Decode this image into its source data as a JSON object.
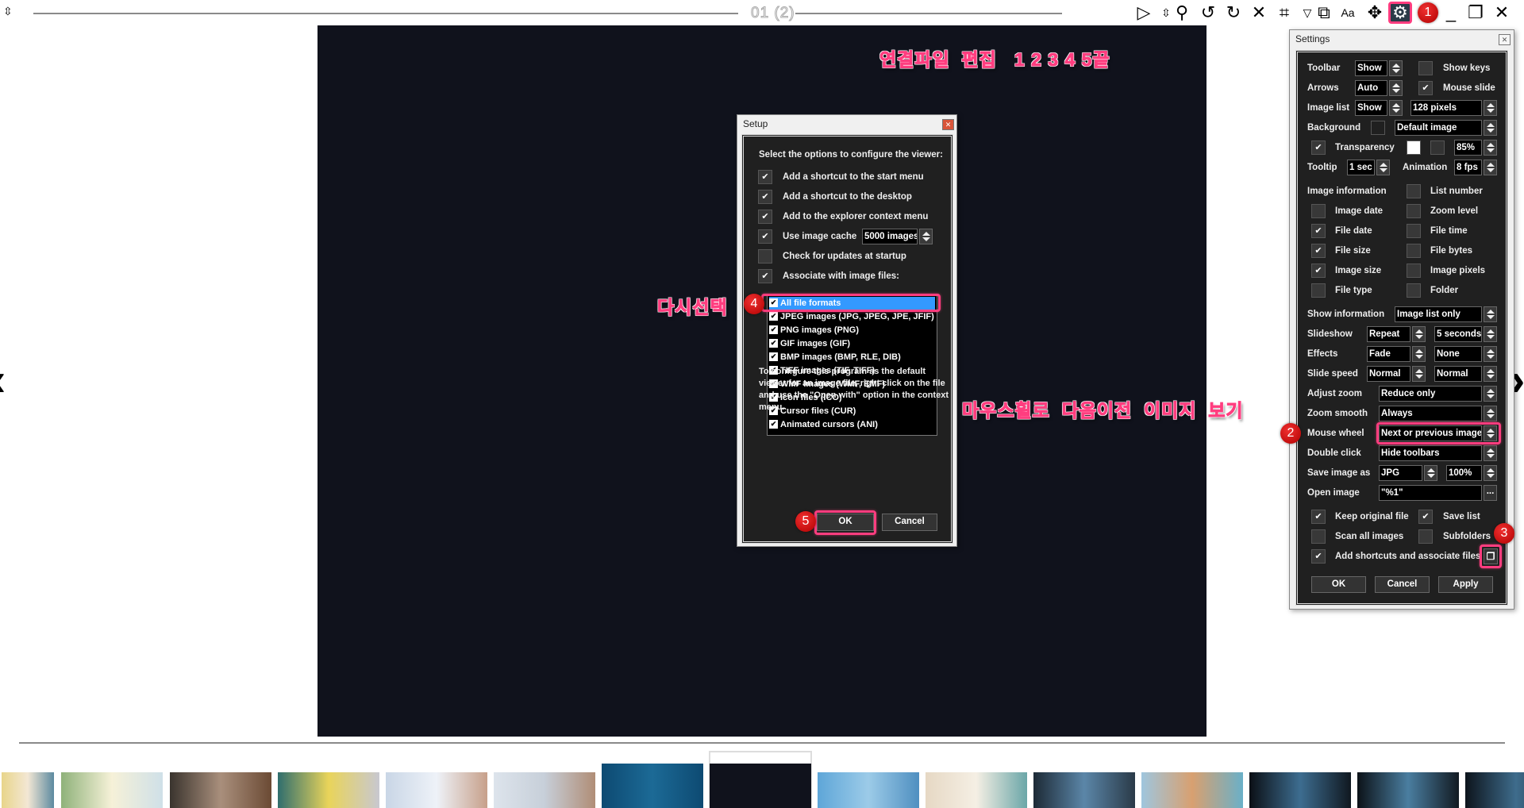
{
  "window": {
    "title": "01 (2)"
  },
  "toolbar": {
    "icons": [
      "menu-toggle-icon",
      "play-icon",
      "zoom-toggle-icon",
      "magnifier-icon",
      "rotate-left-icon",
      "rotate-right-icon",
      "delete-icon",
      "crop-icon",
      "dropdown-icon",
      "find-image-icon",
      "text-icon",
      "move-icon",
      "gear-icon",
      "minimize-icon",
      "restore-icon",
      "close-icon"
    ]
  },
  "annotations": {
    "top_note": "연결파일  편집   1 2 3 4 5끝",
    "reselect_note": "다시선택",
    "wheel_note": "마우스휠로  다음이전  이미지  보기",
    "badges": [
      "1",
      "2",
      "3",
      "4",
      "5"
    ],
    "highlight_color": "#ff3d7f"
  },
  "setup": {
    "title": "Setup",
    "heading": "Select the options to configure the viewer:",
    "options": [
      {
        "label": "Add a shortcut to the start menu",
        "checked": true
      },
      {
        "label": "Add a shortcut to the desktop",
        "checked": true
      },
      {
        "label": "Add to the explorer context menu",
        "checked": true
      },
      {
        "label": "Use image cache",
        "checked": true
      },
      {
        "label": "Check for updates at startup",
        "checked": false
      },
      {
        "label": "Associate with image files:",
        "checked": true
      }
    ],
    "cache_value": "5000 images",
    "formats": [
      {
        "label": "All file formats",
        "checked": true,
        "selected": true
      },
      {
        "label": "JPEG images (JPG, JPEG, JPE, JFIF)",
        "checked": true
      },
      {
        "label": "PNG images (PNG)",
        "checked": true
      },
      {
        "label": "GIF images (GIF)",
        "checked": true
      },
      {
        "label": "BMP images (BMP, RLE, DIB)",
        "checked": true
      },
      {
        "label": "TIFF images (TIF, TIFF)",
        "checked": true
      },
      {
        "label": "WMF images (WMF, EMF)",
        "checked": true
      },
      {
        "label": "Icon files (ICO)",
        "checked": true
      },
      {
        "label": "Cursor files (CUR)",
        "checked": true
      },
      {
        "label": "Animated cursors (ANI)",
        "checked": true
      }
    ],
    "note": "To configure this program as the default viewer for an image file, right click on the file and use the \"Open with\" option in the context menu.",
    "ok": "OK",
    "cancel": "Cancel"
  },
  "settings": {
    "title": "Settings",
    "toolbar": {
      "label": "Toolbar",
      "value": "Show"
    },
    "show_keys": {
      "label": "Show keys",
      "checked": false
    },
    "arrows": {
      "label": "Arrows",
      "value": "Auto"
    },
    "mouse_slide": {
      "label": "Mouse slide",
      "checked": true
    },
    "image_list": {
      "label": "Image list",
      "value": "Show",
      "size": "128 pixels"
    },
    "background": {
      "label": "Background",
      "value": "Default image"
    },
    "transparency": {
      "label": "Transparency",
      "checked": true,
      "value": "85%"
    },
    "tooltip": {
      "label": "Tooltip",
      "value": "1 sec"
    },
    "animation": {
      "label": "Animation",
      "value": "8 fps"
    },
    "image_information": {
      "label": "Image information"
    },
    "info": {
      "list_number": {
        "label": "List number",
        "checked": false
      },
      "image_date": {
        "label": "Image date",
        "checked": false
      },
      "zoom_level": {
        "label": "Zoom level",
        "checked": false
      },
      "file_date": {
        "label": "File date",
        "checked": true
      },
      "file_time": {
        "label": "File time",
        "checked": false
      },
      "file_size": {
        "label": "File size",
        "checked": true
      },
      "file_bytes": {
        "label": "File bytes",
        "checked": false
      },
      "image_size": {
        "label": "Image size",
        "checked": true
      },
      "image_pixels": {
        "label": "Image pixels",
        "checked": false
      },
      "file_type": {
        "label": "File type",
        "checked": false
      },
      "folder": {
        "label": "Folder",
        "checked": false
      }
    },
    "show_information": {
      "label": "Show information",
      "value": "Image list only"
    },
    "slideshow": {
      "label": "Slideshow",
      "value": "Repeat",
      "interval": "5 seconds"
    },
    "effects": {
      "label": "Effects",
      "value": "Fade",
      "value2": "None"
    },
    "slide_speed": {
      "label": "Slide speed",
      "value": "Normal",
      "value2": "Normal"
    },
    "adjust_zoom": {
      "label": "Adjust zoom",
      "value": "Reduce only"
    },
    "zoom_smooth": {
      "label": "Zoom smooth",
      "value": "Always"
    },
    "mouse_wheel": {
      "label": "Mouse wheel",
      "value": "Next or previous image"
    },
    "double_click": {
      "label": "Double click",
      "value": "Hide toolbars"
    },
    "save_image_as": {
      "label": "Save image as",
      "value": "JPG",
      "quality": "100%"
    },
    "open_image": {
      "label": "Open image",
      "value": "\"%1\"",
      "browse": "..."
    },
    "keep_original": {
      "label": "Keep original file",
      "checked": true
    },
    "save_list": {
      "label": "Save list",
      "checked": true
    },
    "scan_all": {
      "label": "Scan all images",
      "checked": false
    },
    "subfolders": {
      "label": "Subfolders",
      "checked": false
    },
    "add_shortcuts": {
      "label": "Add shortcuts and associate files",
      "checked": true
    },
    "ok": "OK",
    "cancel": "Cancel",
    "apply": "Apply"
  },
  "thumbnails": {
    "count": 15,
    "selected_index": 7
  }
}
